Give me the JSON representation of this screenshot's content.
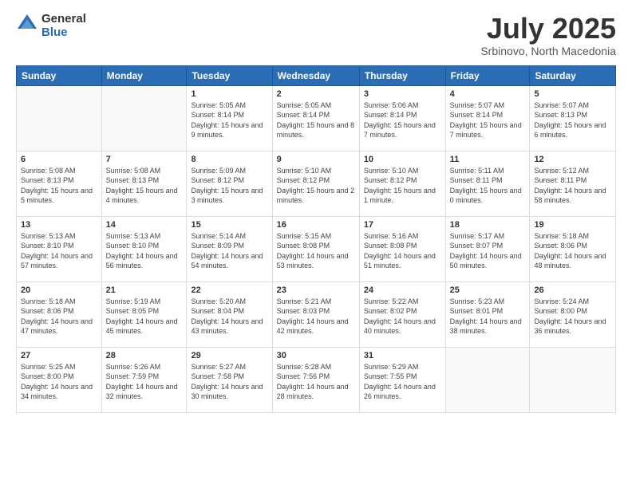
{
  "header": {
    "logo_general": "General",
    "logo_blue": "Blue",
    "month_title": "July 2025",
    "subtitle": "Srbinovo, North Macedonia"
  },
  "weekdays": [
    "Sunday",
    "Monday",
    "Tuesday",
    "Wednesday",
    "Thursday",
    "Friday",
    "Saturday"
  ],
  "weeks": [
    [
      {
        "day": "",
        "sunrise": "",
        "sunset": "",
        "daylight": ""
      },
      {
        "day": "",
        "sunrise": "",
        "sunset": "",
        "daylight": ""
      },
      {
        "day": "1",
        "sunrise": "Sunrise: 5:05 AM",
        "sunset": "Sunset: 8:14 PM",
        "daylight": "Daylight: 15 hours and 9 minutes."
      },
      {
        "day": "2",
        "sunrise": "Sunrise: 5:05 AM",
        "sunset": "Sunset: 8:14 PM",
        "daylight": "Daylight: 15 hours and 8 minutes."
      },
      {
        "day": "3",
        "sunrise": "Sunrise: 5:06 AM",
        "sunset": "Sunset: 8:14 PM",
        "daylight": "Daylight: 15 hours and 7 minutes."
      },
      {
        "day": "4",
        "sunrise": "Sunrise: 5:07 AM",
        "sunset": "Sunset: 8:14 PM",
        "daylight": "Daylight: 15 hours and 7 minutes."
      },
      {
        "day": "5",
        "sunrise": "Sunrise: 5:07 AM",
        "sunset": "Sunset: 8:13 PM",
        "daylight": "Daylight: 15 hours and 6 minutes."
      }
    ],
    [
      {
        "day": "6",
        "sunrise": "Sunrise: 5:08 AM",
        "sunset": "Sunset: 8:13 PM",
        "daylight": "Daylight: 15 hours and 5 minutes."
      },
      {
        "day": "7",
        "sunrise": "Sunrise: 5:08 AM",
        "sunset": "Sunset: 8:13 PM",
        "daylight": "Daylight: 15 hours and 4 minutes."
      },
      {
        "day": "8",
        "sunrise": "Sunrise: 5:09 AM",
        "sunset": "Sunset: 8:12 PM",
        "daylight": "Daylight: 15 hours and 3 minutes."
      },
      {
        "day": "9",
        "sunrise": "Sunrise: 5:10 AM",
        "sunset": "Sunset: 8:12 PM",
        "daylight": "Daylight: 15 hours and 2 minutes."
      },
      {
        "day": "10",
        "sunrise": "Sunrise: 5:10 AM",
        "sunset": "Sunset: 8:12 PM",
        "daylight": "Daylight: 15 hours and 1 minute."
      },
      {
        "day": "11",
        "sunrise": "Sunrise: 5:11 AM",
        "sunset": "Sunset: 8:11 PM",
        "daylight": "Daylight: 15 hours and 0 minutes."
      },
      {
        "day": "12",
        "sunrise": "Sunrise: 5:12 AM",
        "sunset": "Sunset: 8:11 PM",
        "daylight": "Daylight: 14 hours and 58 minutes."
      }
    ],
    [
      {
        "day": "13",
        "sunrise": "Sunrise: 5:13 AM",
        "sunset": "Sunset: 8:10 PM",
        "daylight": "Daylight: 14 hours and 57 minutes."
      },
      {
        "day": "14",
        "sunrise": "Sunrise: 5:13 AM",
        "sunset": "Sunset: 8:10 PM",
        "daylight": "Daylight: 14 hours and 56 minutes."
      },
      {
        "day": "15",
        "sunrise": "Sunrise: 5:14 AM",
        "sunset": "Sunset: 8:09 PM",
        "daylight": "Daylight: 14 hours and 54 minutes."
      },
      {
        "day": "16",
        "sunrise": "Sunrise: 5:15 AM",
        "sunset": "Sunset: 8:08 PM",
        "daylight": "Daylight: 14 hours and 53 minutes."
      },
      {
        "day": "17",
        "sunrise": "Sunrise: 5:16 AM",
        "sunset": "Sunset: 8:08 PM",
        "daylight": "Daylight: 14 hours and 51 minutes."
      },
      {
        "day": "18",
        "sunrise": "Sunrise: 5:17 AM",
        "sunset": "Sunset: 8:07 PM",
        "daylight": "Daylight: 14 hours and 50 minutes."
      },
      {
        "day": "19",
        "sunrise": "Sunrise: 5:18 AM",
        "sunset": "Sunset: 8:06 PM",
        "daylight": "Daylight: 14 hours and 48 minutes."
      }
    ],
    [
      {
        "day": "20",
        "sunrise": "Sunrise: 5:18 AM",
        "sunset": "Sunset: 8:06 PM",
        "daylight": "Daylight: 14 hours and 47 minutes."
      },
      {
        "day": "21",
        "sunrise": "Sunrise: 5:19 AM",
        "sunset": "Sunset: 8:05 PM",
        "daylight": "Daylight: 14 hours and 45 minutes."
      },
      {
        "day": "22",
        "sunrise": "Sunrise: 5:20 AM",
        "sunset": "Sunset: 8:04 PM",
        "daylight": "Daylight: 14 hours and 43 minutes."
      },
      {
        "day": "23",
        "sunrise": "Sunrise: 5:21 AM",
        "sunset": "Sunset: 8:03 PM",
        "daylight": "Daylight: 14 hours and 42 minutes."
      },
      {
        "day": "24",
        "sunrise": "Sunrise: 5:22 AM",
        "sunset": "Sunset: 8:02 PM",
        "daylight": "Daylight: 14 hours and 40 minutes."
      },
      {
        "day": "25",
        "sunrise": "Sunrise: 5:23 AM",
        "sunset": "Sunset: 8:01 PM",
        "daylight": "Daylight: 14 hours and 38 minutes."
      },
      {
        "day": "26",
        "sunrise": "Sunrise: 5:24 AM",
        "sunset": "Sunset: 8:00 PM",
        "daylight": "Daylight: 14 hours and 36 minutes."
      }
    ],
    [
      {
        "day": "27",
        "sunrise": "Sunrise: 5:25 AM",
        "sunset": "Sunset: 8:00 PM",
        "daylight": "Daylight: 14 hours and 34 minutes."
      },
      {
        "day": "28",
        "sunrise": "Sunrise: 5:26 AM",
        "sunset": "Sunset: 7:59 PM",
        "daylight": "Daylight: 14 hours and 32 minutes."
      },
      {
        "day": "29",
        "sunrise": "Sunrise: 5:27 AM",
        "sunset": "Sunset: 7:58 PM",
        "daylight": "Daylight: 14 hours and 30 minutes."
      },
      {
        "day": "30",
        "sunrise": "Sunrise: 5:28 AM",
        "sunset": "Sunset: 7:56 PM",
        "daylight": "Daylight: 14 hours and 28 minutes."
      },
      {
        "day": "31",
        "sunrise": "Sunrise: 5:29 AM",
        "sunset": "Sunset: 7:55 PM",
        "daylight": "Daylight: 14 hours and 26 minutes."
      },
      {
        "day": "",
        "sunrise": "",
        "sunset": "",
        "daylight": ""
      },
      {
        "day": "",
        "sunrise": "",
        "sunset": "",
        "daylight": ""
      }
    ]
  ]
}
